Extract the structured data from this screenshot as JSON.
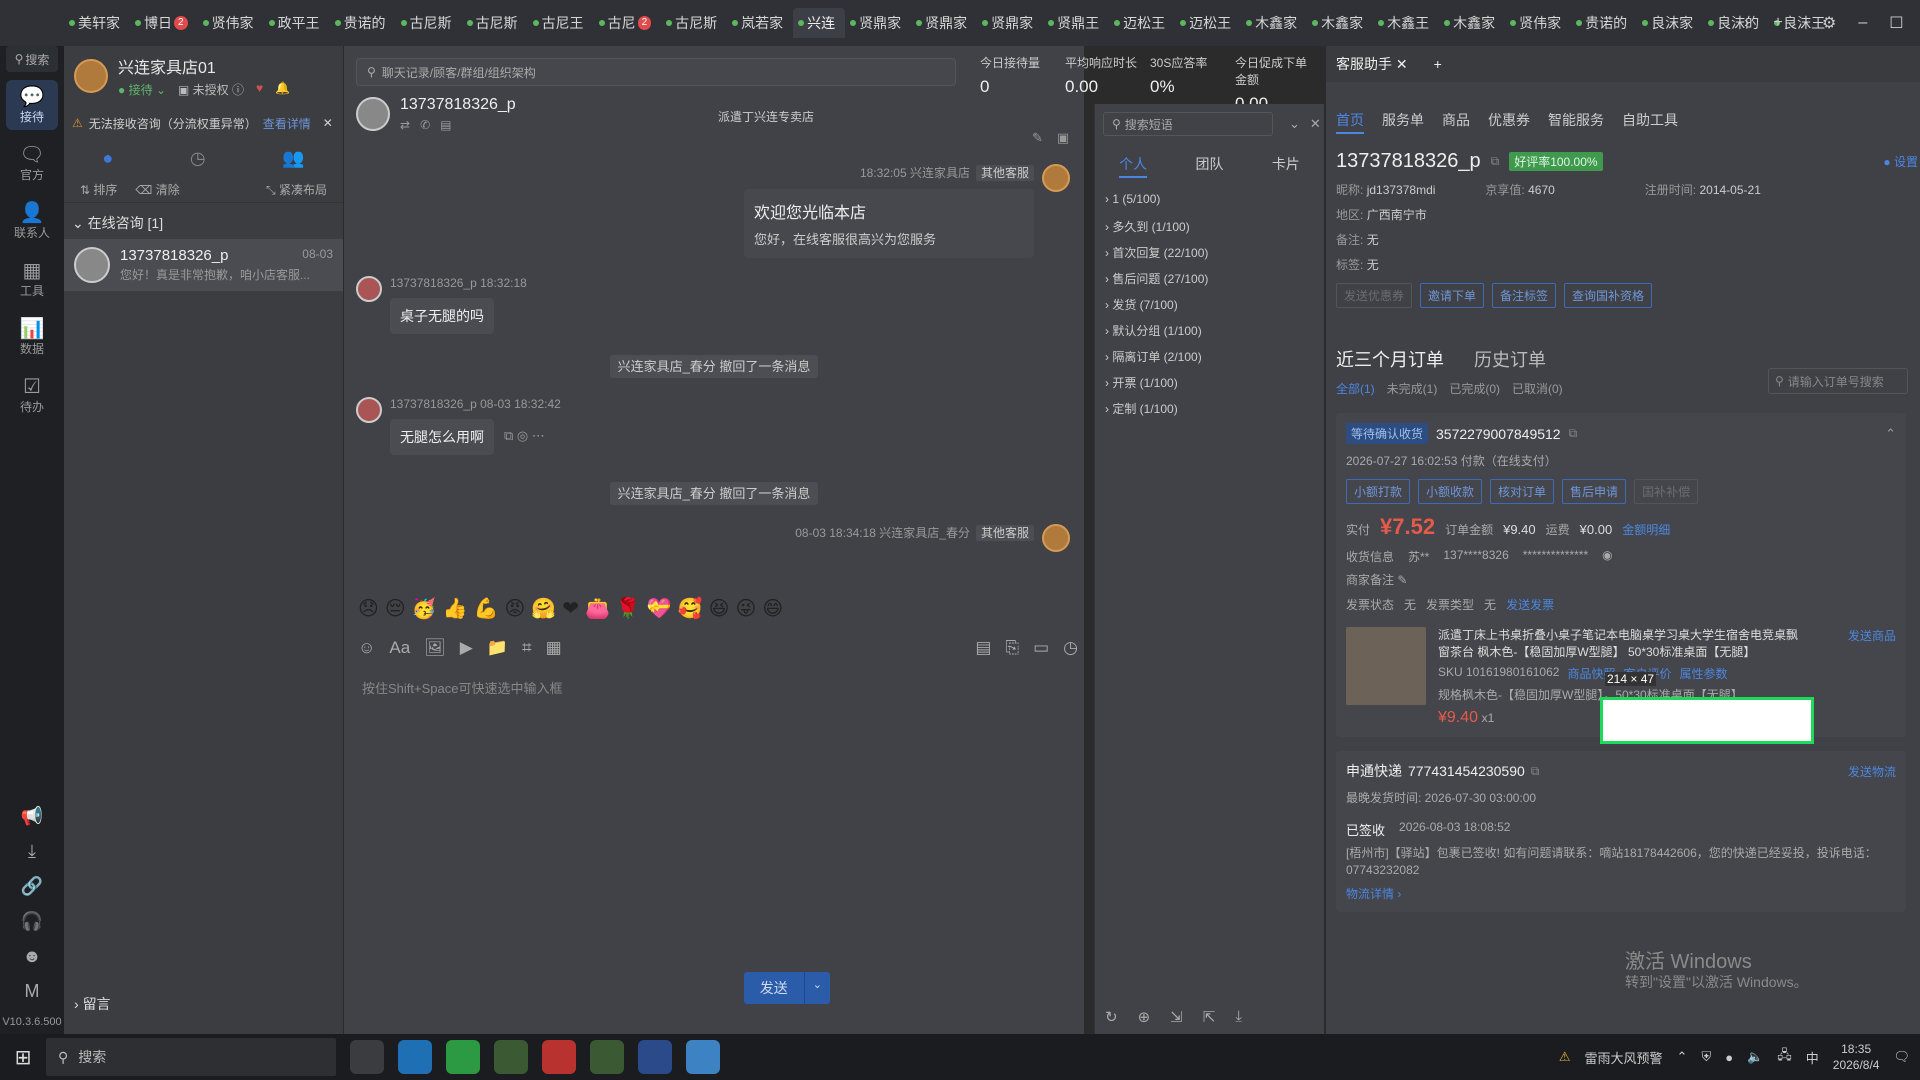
{
  "tabs": [
    {
      "label": "美轩家",
      "badge": ""
    },
    {
      "label": "博日",
      "badge": "2"
    },
    {
      "label": "贤伟家",
      "badge": ""
    },
    {
      "label": "政平王",
      "badge": ""
    },
    {
      "label": "贵诺的",
      "badge": ""
    },
    {
      "label": "古尼斯",
      "badge": ""
    },
    {
      "label": "古尼斯",
      "badge": ""
    },
    {
      "label": "古尼王",
      "badge": ""
    },
    {
      "label": "古尼",
      "badge": "2"
    },
    {
      "label": "古尼斯",
      "badge": ""
    },
    {
      "label": "岚若家",
      "badge": ""
    },
    {
      "label": "兴连",
      "badge": ""
    },
    {
      "label": "贤鼎家",
      "badge": ""
    },
    {
      "label": "贤鼎家",
      "badge": ""
    },
    {
      "label": "贤鼎家",
      "badge": ""
    },
    {
      "label": "贤鼎王",
      "badge": ""
    },
    {
      "label": "迈松王",
      "badge": ""
    },
    {
      "label": "迈松王",
      "badge": ""
    },
    {
      "label": "木鑫家",
      "badge": ""
    },
    {
      "label": "木鑫家",
      "badge": ""
    },
    {
      "label": "木鑫王",
      "badge": ""
    },
    {
      "label": "木鑫家",
      "badge": ""
    },
    {
      "label": "贤伟家",
      "badge": ""
    },
    {
      "label": "贵诺的",
      "badge": ""
    },
    {
      "label": "良沫家",
      "badge": ""
    },
    {
      "label": "良沫的",
      "badge": ""
    },
    {
      "label": "良沫王",
      "badge": ""
    }
  ],
  "rail": {
    "search": "搜索",
    "items": [
      "接待",
      "官方",
      "联系人",
      "工具",
      "数据",
      "待办"
    ],
    "version": "V10.3.6.500"
  },
  "shop": {
    "name": "兴连家具店01",
    "status": "接待",
    "auth": "未授权"
  },
  "warn": {
    "text": "无法接收咨询（分流权重异常）",
    "link": "查看详情"
  },
  "convtools": [
    "排序",
    "清除",
    "紧凑布局"
  ],
  "group": "在线咨询 [1]",
  "conv": {
    "name": "13737818326_p",
    "time": "08-03",
    "preview": "您好！真是非常抱歉，咱小店客服..."
  },
  "leave": "留言",
  "chat": {
    "search_placeholder": "聊天记录/顾客/群组/组织架构",
    "stats": [
      {
        "label": "今日接待量",
        "value": "0"
      },
      {
        "label": "平均响应时长",
        "value": "0.00"
      },
      {
        "label": "30S应答率",
        "value": "0%"
      },
      {
        "label": "今日促成下单金额",
        "value": "0.00"
      }
    ],
    "customer": "13737818326_p",
    "transfer": "派遣丁兴连专卖店",
    "msg1_meta": "18:32:05  兴连家具店",
    "msg1_tag": "其他客服",
    "msg1_title": "欢迎您光临本店",
    "msg1_body": "您好，在线客服很高兴为您服务",
    "msg2_meta": "13737818326_p  18:32:18",
    "msg2_text": "桌子无腿的吗",
    "sys1": "兴连家具店_春分 撤回了一条消息",
    "msg3_meta": "13737818326_p  08-03 18:32:42",
    "msg3_text": "无腿怎么用啊",
    "sys2": "兴连家具店_春分 撤回了一条消息",
    "msg4_meta": "08-03 18:34:18  兴连家具店_春分",
    "msg4_tag": "其他客服",
    "input_placeholder": "按住Shift+Space可快速选中输入框",
    "send": "发送"
  },
  "quick": {
    "search_placeholder": "搜索短语",
    "tabs": [
      "个人",
      "团队",
      "卡片"
    ],
    "items": [
      "1 (5/100)",
      "多久到 (1/100)",
      "首次回复 (22/100)",
      "售后问题 (27/100)",
      "发货 (7/100)",
      "默认分组 (1/100)",
      "隔离订单 (2/100)",
      "开票 (1/100)",
      "定制 (1/100)"
    ]
  },
  "assist": {
    "tab": "客服助手",
    "nav": [
      "首页",
      "服务单",
      "商品",
      "优惠券",
      "智能服务",
      "自助工具"
    ],
    "customer": "13737818326_p",
    "good_rate": "好评率100.00%",
    "settings": "设置",
    "nick_label": "昵称:",
    "nick": "jd137378mdi",
    "jx_label": "京享值:",
    "jx": "4670",
    "reg_label": "注册时间:",
    "reg": "2014-05-21",
    "area_label": "地区:",
    "area": "广西南宁市",
    "remark_label": "备注:",
    "remark": "无",
    "tag_label": "标签:",
    "tag": "无",
    "buttons": [
      "发送优惠券",
      "邀请下单",
      "备注标签",
      "查询国补资格"
    ],
    "order_tabs": [
      "近三个月订单",
      "历史订单"
    ],
    "filters": [
      "全部(1)",
      "未完成(1)",
      "已完成(0)",
      "已取消(0)"
    ],
    "order_search_placeholder": "请输入订单号搜索",
    "order": {
      "status": "等待确认收货",
      "no": "3572279007849512",
      "paid": "2026-07-27 16:02:53 付款（在线支付）",
      "actions": [
        "小额打款",
        "小额收款",
        "核对订单",
        "售后申请",
        "国补补偿"
      ],
      "actual_label": "实付",
      "actual": "¥7.52",
      "amount_label": "订单金额",
      "amount": "¥9.40",
      "ship_label": "运费",
      "ship": "¥0.00",
      "detail_link": "金额明细",
      "recv_label": "收货信息",
      "recv_name": "苏**",
      "recv_phone": "137****8326",
      "recv_addr": "**************",
      "merchant_note": "商家备注",
      "invoice_label": "发票状态",
      "invoice": "无",
      "invoice_type_label": "发票类型",
      "invoice_type": "无",
      "send_invoice": "发送发票",
      "product_title": "派遣丁床上书桌折叠小桌子笔记本电脑桌学习桌大学生宿舍电竞桌飘窗茶台 枫木色-【稳固加厚W型腿】 50*30标准桌面【无腿】",
      "sku": "SKU 10161980161062",
      "sku_links": [
        "商品快照",
        "客户评价",
        "属性参数"
      ],
      "spec": "规格枫木色-【稳固加厚W型腿】，50*30标准桌面【无腿】",
      "price": "¥9.40",
      "qty": "x1",
      "send_product": "发送商品",
      "express_label": "申通快递",
      "express_no": "777431454230590",
      "send_logistics": "发送物流",
      "latest_ship": "最晚发货时间: 2026-07-30 03:00:00",
      "signed": "已签收",
      "signed_time": "2026-08-03 18:08:52",
      "track": "[梧州市]【驿站】包裹已签收! 如有问题请联系：嘀站18178442606，您的快递已经妥投，投诉电话：07743232082",
      "logistics_detail": "物流详情"
    }
  },
  "overlay": {
    "size_label": "214 × 47"
  },
  "watermark": {
    "line1": "激活 Windows",
    "line2": "转到\"设置\"以激活 Windows。"
  },
  "taskbar": {
    "search": "搜索",
    "weather": "雷雨大风预警",
    "time": "18:35",
    "date": "2026/8/4",
    "ime": "中"
  }
}
